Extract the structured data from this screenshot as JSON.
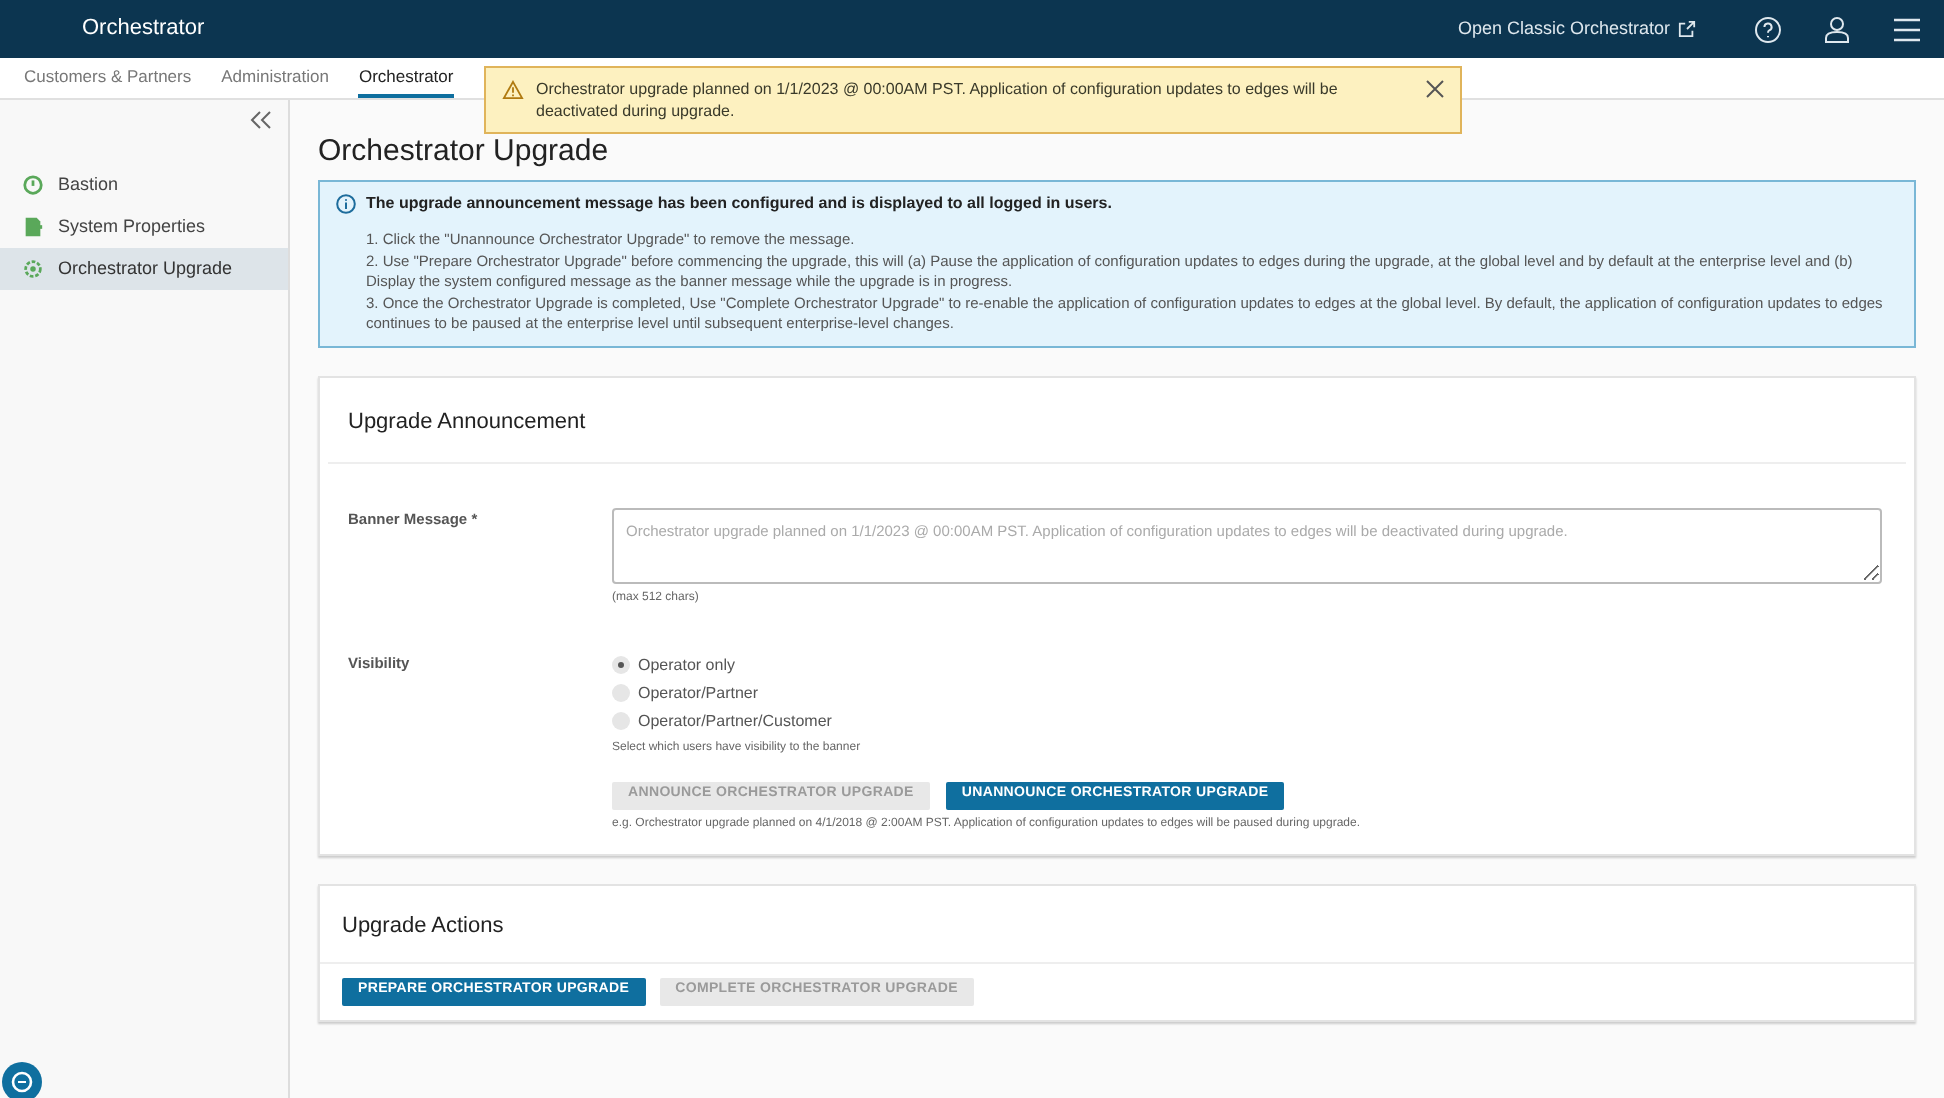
{
  "header": {
    "title": "Orchestrator",
    "link": "Open Classic Orchestrator"
  },
  "tabs": [
    {
      "label": "Customers & Partners",
      "selected": false
    },
    {
      "label": "Administration",
      "selected": false
    },
    {
      "label": "Orchestrator",
      "selected": true
    }
  ],
  "alert": {
    "text": "Orchestrator upgrade planned on 1/1/2023 @ 00:00AM PST. Application of configuration updates to edges will be deactivated during upgrade."
  },
  "sidebar": {
    "items": [
      {
        "label": "Bastion",
        "kind": "bastion",
        "selected": false
      },
      {
        "label": "System Properties",
        "kind": "properties",
        "selected": false
      },
      {
        "label": "Orchestrator Upgrade",
        "kind": "upgrade",
        "selected": true
      }
    ]
  },
  "page_title": "Orchestrator Upgrade",
  "info": {
    "heading": "The upgrade announcement message has been configured and is displayed to all logged in users.",
    "lines": [
      "1. Click the \"Unannounce Orchestrator Upgrade\" to remove the message.",
      "2. Use \"Prepare Orchestrator Upgrade\" before commencing the upgrade, this will (a) Pause the application of configuration updates to edges during the upgrade, at the global level and by default at the enterprise level and (b) Display the system configured message as the banner message while the upgrade is in progress.",
      "3. Once the Orchestrator Upgrade is completed, Use \"Complete Orchestrator Upgrade\" to re-enable the application of configuration updates to edges at the global level. By default, the application of configuration updates to edges continues to be paused at the enterprise level until subsequent enterprise-level changes."
    ]
  },
  "announcement": {
    "title": "Upgrade Announcement",
    "banner_label": "Banner Message *",
    "banner_placeholder": "Orchestrator upgrade planned on 1/1/2023 @ 00:00AM PST. Application of configuration updates to edges will be deactivated during upgrade.",
    "banner_hint": "(max 512 chars)",
    "visibility_label": "Visibility",
    "options": [
      {
        "label": "Operator only",
        "selected": true
      },
      {
        "label": "Operator/Partner",
        "selected": false
      },
      {
        "label": "Operator/Partner/Customer",
        "selected": false
      }
    ],
    "visibility_hint": "Select which users have visibility to the banner",
    "buttons": [
      {
        "label": "ANNOUNCE ORCHESTRATOR UPGRADE",
        "disabled": true
      },
      {
        "label": "UNANNOUNCE ORCHESTRATOR UPGRADE",
        "disabled": false
      }
    ],
    "example": "e.g. Orchestrator upgrade planned on 4/1/2018 @ 2:00AM PST. Application of configuration updates to edges will be paused during upgrade."
  },
  "actions": {
    "title": "Upgrade Actions",
    "buttons": [
      {
        "label": "PREPARE ORCHESTRATOR UPGRADE",
        "disabled": false
      },
      {
        "label": "COMPLETE ORCHESTRATOR UPGRADE",
        "disabled": true
      }
    ]
  }
}
